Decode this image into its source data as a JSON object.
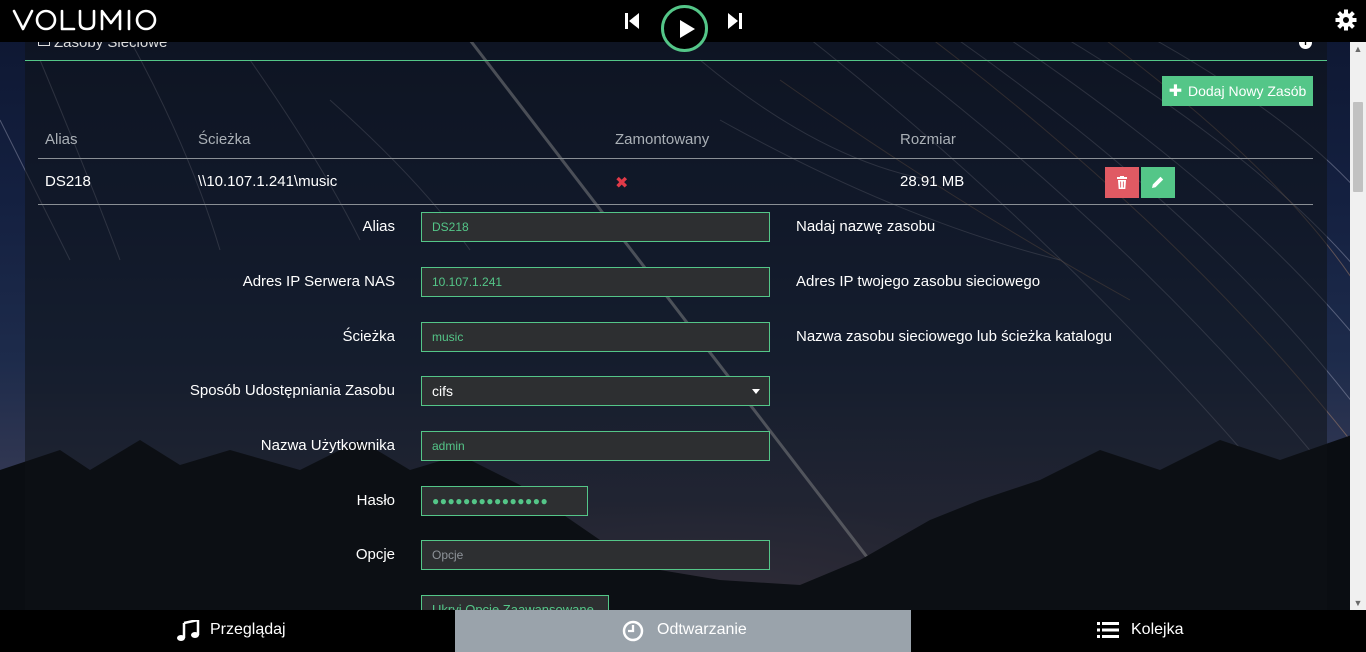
{
  "app": {
    "logo": "volumio"
  },
  "player": {
    "prev_icon": "skip-previous-icon",
    "play_icon": "play-icon",
    "next_icon": "skip-next-icon",
    "accent": "#54c688"
  },
  "panel": {
    "title": "Zasoby Sieciowe",
    "add_button": "Dodaj Nowy Zasób",
    "table": {
      "headers": [
        "Alias",
        "Ścieżka",
        "Zamontowany",
        "Rozmiar"
      ],
      "rows": [
        {
          "alias": "DS218",
          "path": "\\\\10.107.1.241\\music",
          "mounted": "✖",
          "size": "28.91 MB"
        }
      ]
    }
  },
  "form": {
    "alias": {
      "label": "Alias",
      "value": "DS218",
      "help": "Nadaj nazwę zasobu"
    },
    "ip": {
      "label": "Adres IP Serwera NAS",
      "value": "10.107.1.241",
      "help": "Adres IP twojego zasobu sieciowego"
    },
    "path": {
      "label": "Ścieżka",
      "value": "music",
      "help": "Nazwa zasobu sieciowego lub ścieżka katalogu"
    },
    "share_type": {
      "label": "Sposób Udostępniania Zasobu",
      "value": "cifs"
    },
    "username": {
      "label": "Nazwa Użytkownika",
      "value": "admin"
    },
    "password": {
      "label": "Hasło",
      "value": "●●●●●●●●●●●●●●●"
    },
    "options": {
      "label": "Opcje",
      "placeholder": "Opcje"
    },
    "advanced_button": "Ukryj Opcje Zaawansowane"
  },
  "bottom_nav": [
    {
      "label": "Przeglądaj",
      "icon": "music-note-icon"
    },
    {
      "label": "Odtwarzanie",
      "icon": "clock-icon"
    },
    {
      "label": "Kolejka",
      "icon": "list-icon"
    }
  ],
  "colors": {
    "accent": "#54c688",
    "danger": "#e05a63",
    "active_tab": "#9aa3ab"
  }
}
